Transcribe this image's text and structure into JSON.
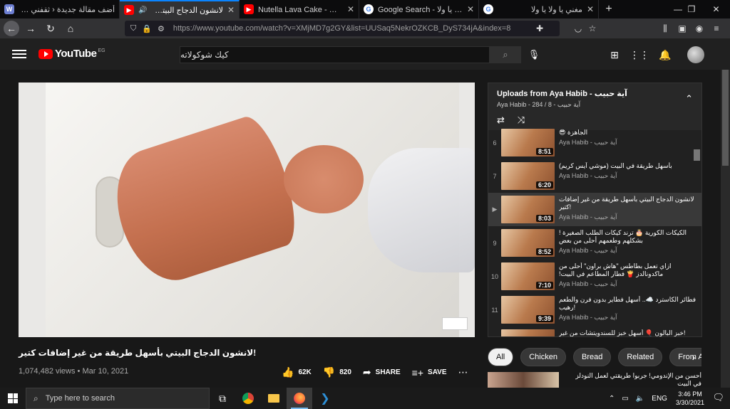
{
  "browser": {
    "tabs": [
      {
        "title": "أضف مقالة جديدة ‹ ثقفني — ووردبريس",
        "favicon": "wordpress-icon",
        "active": false
      },
      {
        "title": "لانشون الدجاج البيتي بأسهل",
        "favicon": "youtube-icon",
        "active": true,
        "audio": true
      },
      {
        "title": "Nutella Lava Cake - لافا كيك",
        "favicon": "youtube-icon",
        "active": false
      },
      {
        "title": "Google Search - يا ولا يا ولا",
        "favicon": "google-icon",
        "active": false
      },
      {
        "title": "مغني يا ولا يا ولا",
        "favicon": "google-icon",
        "active": false
      }
    ],
    "new_tab_symbol": "+",
    "url": "https://www.youtube.com/watch?v=XMjMD7g2GY&list=UUSaq5NekrOZKCB_DyS734jA&index=8"
  },
  "yt": {
    "logo_text": "YouTube",
    "country_code": "EG",
    "search_query": "كيك شوكولاته"
  },
  "video": {
    "title": "!لانشون الدجاج البيتي بأسهل طريقة من غير إضافات كتير",
    "views": "1,074,482 views • Mar 10, 2021",
    "likes": "62K",
    "dislikes": "820",
    "share_label": "SHARE",
    "save_label": "SAVE"
  },
  "playlist": {
    "title": "Uploads from Aya Habib - آية حبيب",
    "subtitle": "Aya Habib - آية حبيب - 8 / 284",
    "items": [
      {
        "index": "6",
        "title": "الجاهزة 😎",
        "duration": "8:51",
        "channel": "Aya Habib - آية حبيب",
        "current": false
      },
      {
        "index": "7",
        "title": "بأسهل طريقة في البيت (موشي آيس كريم)",
        "duration": "6:20",
        "channel": "Aya Habib - آية حبيب",
        "current": false
      },
      {
        "index": "▶",
        "title": "لانشون الدجاج البيتي بأسهل طريقة من غير إضافات !كتير",
        "duration": "8:03",
        "channel": "Aya Habib - آية حبيب",
        "current": true
      },
      {
        "index": "9",
        "title": "الكيكات الكورية 🎂 ترند كيكات الطلب الصغيرة !بشكلهم وطعمهم أحلى من بعض",
        "duration": "8:52",
        "channel": "Aya Habib - آية حبيب",
        "current": false
      },
      {
        "index": "10",
        "title": "ازاي تعمل بطاطس \"هاش براون\" أحلى من ماكدونالدز 🍟 فطار المطاعم في البيت!",
        "duration": "7:10",
        "channel": "Aya Habib - آية حبيب",
        "current": false
      },
      {
        "index": "11",
        "title": "فطائر الكاسترد ☁️.. أسهل فطاير بدون فرن والطعم !رهيب",
        "duration": "9:39",
        "channel": "Aya Habib - آية حبيب",
        "current": false
      },
      {
        "index": "",
        "title": "!خبز البالون 🎈 أسهل خبز للسندويتشات من غير فرن",
        "duration": "",
        "channel": "",
        "current": false
      }
    ]
  },
  "chips": [
    "All",
    "Chicken",
    "Bread",
    "Related",
    "From Aya Habib"
  ],
  "recommendation": {
    "title": "أحسن من الإندومي! جربوا طريقتي لعمل النودلز في البيت"
  },
  "taskbar": {
    "search_placeholder": "Type here to search",
    "lang": "ENG",
    "time": "3:46 PM",
    "date": "3/30/2021"
  }
}
